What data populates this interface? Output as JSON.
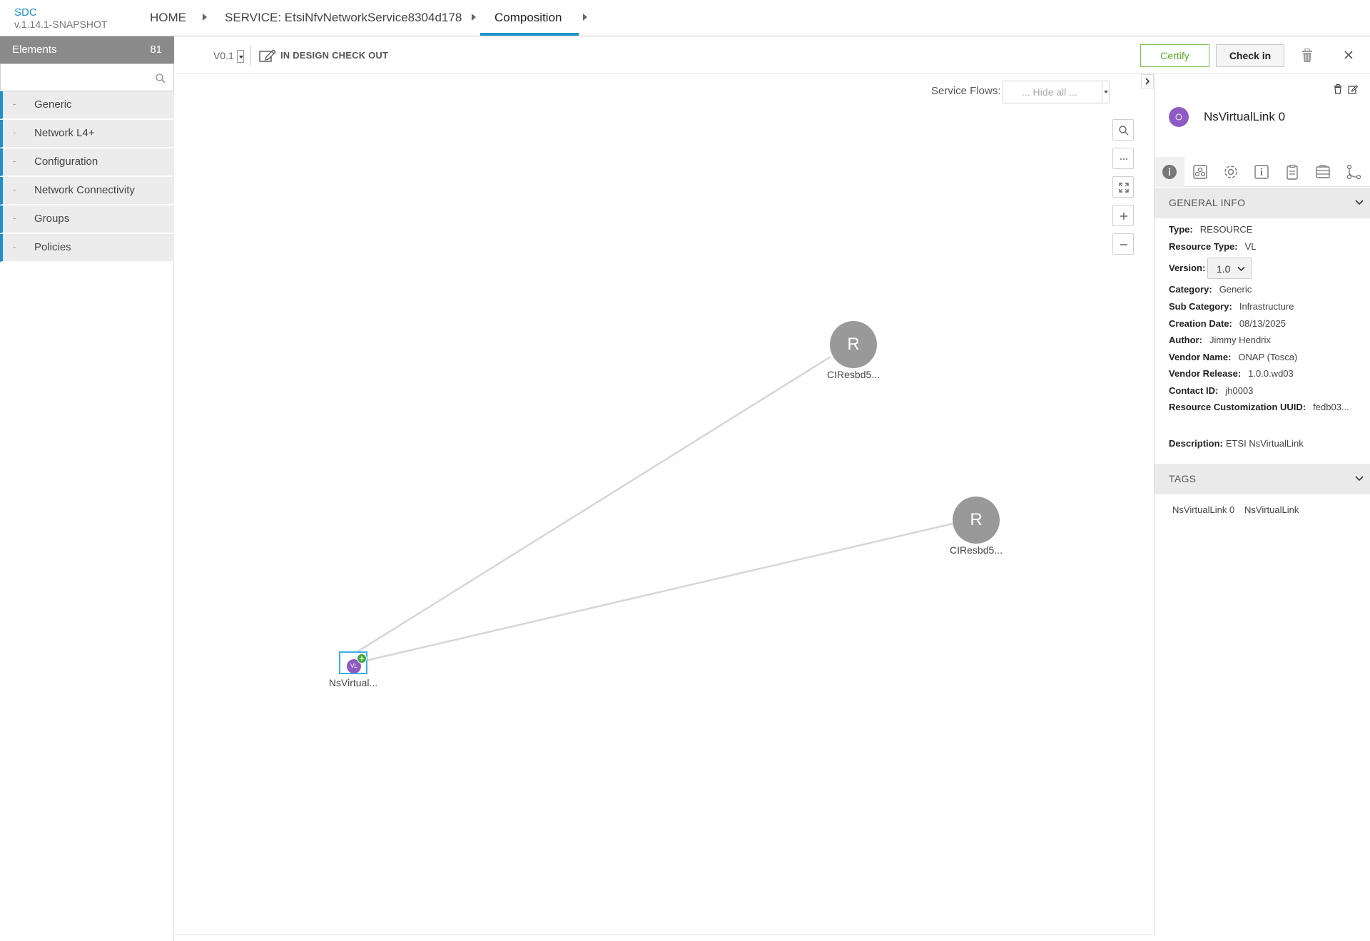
{
  "brand": {
    "name": "SDC",
    "version": "v.1.14.1-SNAPSHOT"
  },
  "nav": {
    "home": "HOME",
    "service": "SERVICE: EtsiNfvNetworkService8304d178",
    "current": "Composition"
  },
  "palette": {
    "title": "Elements",
    "count": "81",
    "search_placeholder": "",
    "categories": [
      {
        "dash": "-",
        "label": "Generic"
      },
      {
        "dash": "-",
        "label": "Network L4+"
      },
      {
        "dash": "-",
        "label": "Configuration"
      },
      {
        "dash": "-",
        "label": "Network Connectivity"
      },
      {
        "dash": "-",
        "label": "Groups"
      },
      {
        "dash": "-",
        "label": "Policies"
      }
    ]
  },
  "toolbar": {
    "version": "V0.1",
    "status": "IN DESIGN CHECK OUT",
    "certify_label": "Certify",
    "checkin_label": "Check in"
  },
  "canvas": {
    "service_flows_label": "Service Flows:",
    "service_flows_value": "... Hide all ...",
    "zoom_more": "...",
    "nodes": [
      {
        "letter": "R",
        "label": "CIResbd5..."
      },
      {
        "letter": "R",
        "label": "CIResbd5..."
      },
      {
        "letter": "VL",
        "label": "NsVirtual..."
      }
    ]
  },
  "details": {
    "title": "NsVirtualLink 0",
    "general_info_header": "GENERAL INFO",
    "fields": {
      "type_label": "Type:",
      "type_value": "RESOURCE",
      "rtype_label": "Resource Type:",
      "rtype_value": "VL",
      "version_label": "Version:",
      "version_value": "1.0",
      "category_label": "Category:",
      "category_value": "Generic",
      "subcategory_label": "Sub Category:",
      "subcategory_value": "Infrastructure",
      "creation_label": "Creation Date:",
      "creation_value": "08/13/2025",
      "author_label": "Author:",
      "author_value": "Jimmy Hendrix",
      "vendor_label": "Vendor Name:",
      "vendor_value": "ONAP (Tosca)",
      "release_label": "Vendor Release:",
      "release_value": "1.0.0.wd03",
      "contact_label": "Contact ID:",
      "contact_value": "jh0003",
      "uuid_label": "Resource Customization UUID:",
      "uuid_value": "fedb03...",
      "description_label": "Description:",
      "description_value": "ETSI NsVirtualLink"
    },
    "tags_header": "TAGS",
    "tags": [
      "NsVirtualLink 0",
      "NsVirtualLink"
    ]
  },
  "colors": {
    "accent": "#1e90cc",
    "certify": "#5aa826",
    "vl_node": "#8e5ac3",
    "resource_node": "#999999"
  }
}
